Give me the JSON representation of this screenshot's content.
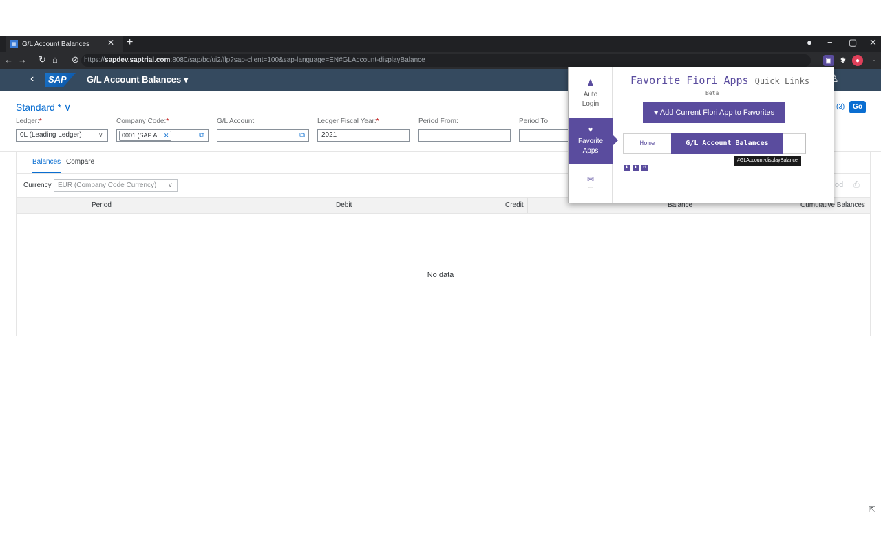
{
  "browser": {
    "tab_title": "G/L Account Balances",
    "url_prefix": "https://",
    "url_host": "sapdev.saptrial.com",
    "url_rest": ":8080/sap/bc/ui2/flp?sap-client=100&sap-language=EN#GLAccount-displayBalance"
  },
  "shell": {
    "logo": "SAP",
    "app_title": "G/L Account Balances ▾"
  },
  "filterbar": {
    "variant": "Standard * ∨",
    "go_count": "(3)",
    "go_label": "Go",
    "fields": {
      "ledger_label": "Ledger:",
      "ledger_value": "0L (Leading Ledger)",
      "company_label": "Company Code:",
      "company_token": "0001 (SAP A...",
      "account_label": "G/L Account:",
      "fiscal_label": "Ledger Fiscal Year:",
      "fiscal_value": "2021",
      "period_from_label": "Period From:",
      "period_to_label": "Period To:"
    },
    "required_mark": "*"
  },
  "content": {
    "tabs": [
      "Balances",
      "Compare"
    ],
    "currency_label": "Currency",
    "currency_value": "EUR (Company Code Currency)",
    "columns": [
      "Period",
      "Debit",
      "Credit",
      "Balance",
      "Cumulative Balances"
    ],
    "no_data": "No data",
    "toolbar_partial": "od"
  },
  "popup": {
    "title": "Favorite Fiori Apps",
    "title_suffix": "Quick Links",
    "beta": "Beta",
    "side": {
      "auto_login": "Auto Login",
      "favorite_apps": "Favorite Apps",
      "more": "...."
    },
    "add_button": "♥ Add Current Flori App to Favorites",
    "crumbs": {
      "home": "Home",
      "current": "G/L Account Balances"
    },
    "tooltip": "#GLAccount-displayBalance"
  },
  "colors": {
    "shell": "#354a5f",
    "accent": "#0a6ed1",
    "popup_accent": "#5a4c9e"
  }
}
